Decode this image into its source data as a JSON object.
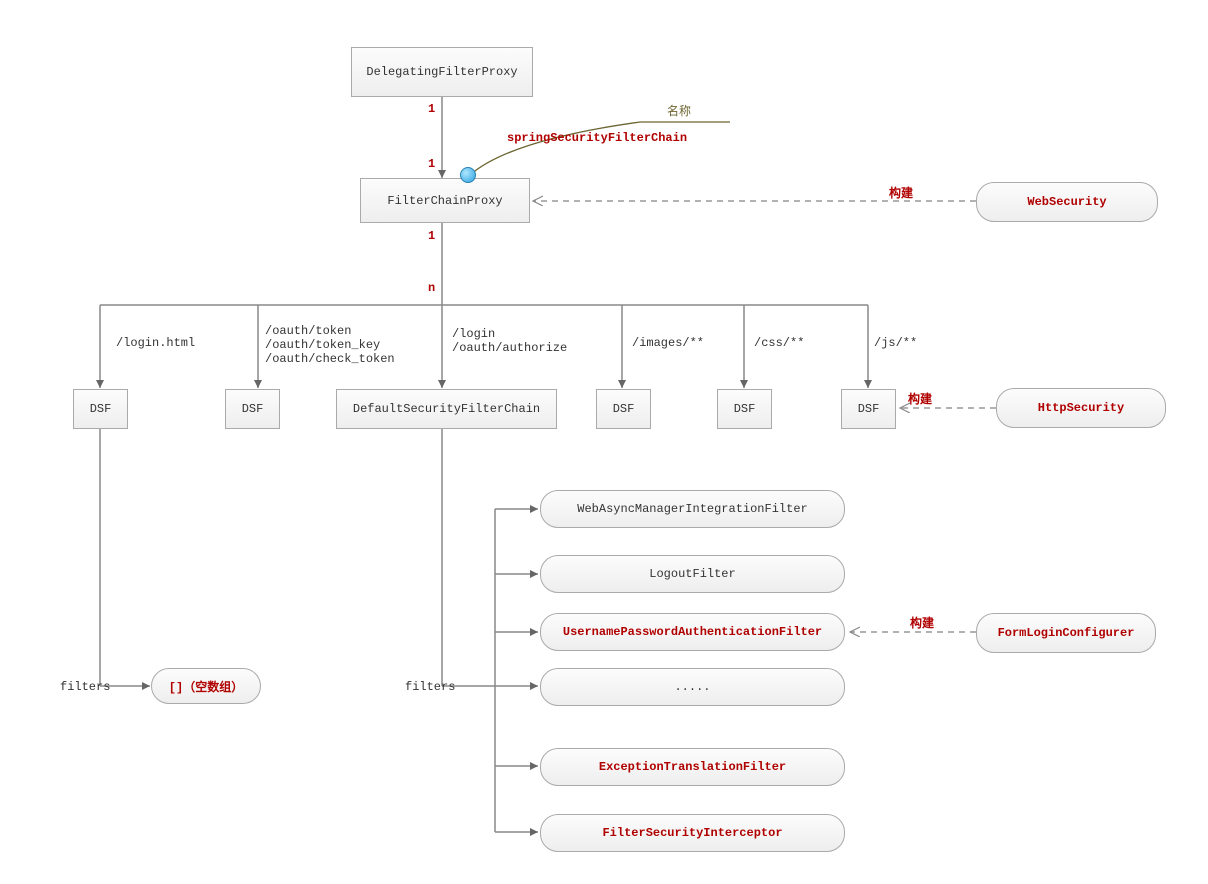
{
  "nodes": {
    "delegatingFilterProxy": "DelegatingFilterProxy",
    "filterChainProxy": "FilterChainProxy",
    "webSecurity": "WebSecurity",
    "httpSecurity": "HttpSecurity",
    "formLoginConfigurer": "FormLoginConfigurer",
    "dsf1": "DSF",
    "dsf2": "DSF",
    "defaultSecurityFilterChain": "DefaultSecurityFilterChain",
    "dsf4": "DSF",
    "dsf5": "DSF",
    "dsf6": "DSF",
    "emptyArray": "[]（空数组）"
  },
  "paths": {
    "p1": "/login.html",
    "p2a": "/oauth/token",
    "p2b": "/oauth/token_key",
    "p2c": "/oauth/check_token",
    "p3a": "/login",
    "p3b": "/oauth/authorize",
    "p4": "/images/**",
    "p5": "/css/**",
    "p6": "/js/**"
  },
  "filters": {
    "f1": "WebAsyncManagerIntegrationFilter",
    "f2": "LogoutFilter",
    "f3": "UsernamePasswordAuthenticationFilter",
    "f4": ".....",
    "f5": "ExceptionTranslationFilter",
    "f6": "FilterSecurityInterceptor"
  },
  "labels": {
    "one_a": "1",
    "one_b": "1",
    "one_c": "1",
    "n": "n",
    "name_title": "名称",
    "springChain": "springSecurityFilterChain",
    "build1": "构建",
    "build2": "构建",
    "build3": "构建",
    "filters1": "filters",
    "filters2": "filters"
  }
}
